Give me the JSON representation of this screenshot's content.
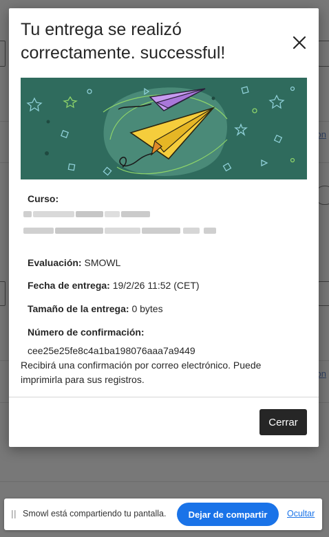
{
  "modal": {
    "title": "Tu entrega se realizó correctamente. successful!",
    "close_icon": "close-icon",
    "details": {
      "curso_label": "Curso:",
      "evaluacion_label": "Evaluación:",
      "evaluacion_value": "SMOWL",
      "fecha_label": "Fecha de entrega:",
      "fecha_value": "19/2/26 11:52 (CET)",
      "tamano_label": "Tamaño de la entrega:",
      "tamano_value": "0 bytes",
      "confirmacion_label": "Número de confirmación:",
      "confirmacion_value": "cee25e25fe8c4a1ba198076aaa7a9449"
    },
    "note": "Recibirá una confirmación por correo electrónico. Puede imprimirla para sus registros.",
    "close_button": "Cerrar"
  },
  "background": {
    "link_text": "on"
  },
  "share_bar": {
    "text": "Smowl está compartiendo tu pantalla.",
    "stop_button": "Dejar de compartir",
    "hide_link": "Ocultar"
  },
  "colors": {
    "banner_bg": "#2f6b5d",
    "button_dark": "#262626",
    "share_blue": "#1a73e8"
  }
}
